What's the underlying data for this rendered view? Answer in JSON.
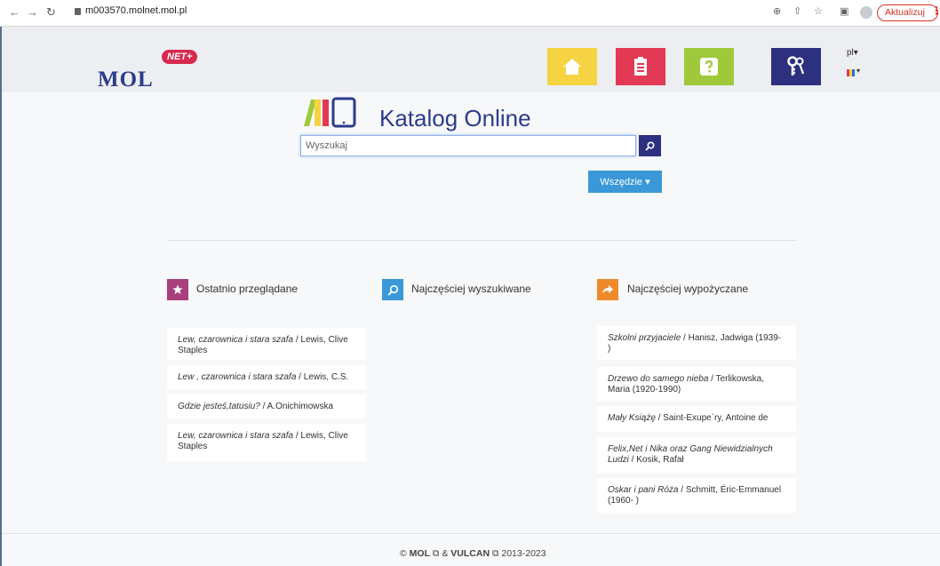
{
  "browser": {
    "url": "m003570.molnet.mol.pl",
    "update_label": "Aktualizuj"
  },
  "header": {
    "logo_main": "MOL",
    "logo_badge": "NET+",
    "lang_label": "pl"
  },
  "hero": {
    "title": "Katalog Online",
    "search_placeholder": "Wyszukaj",
    "scope_label": "Wszędzie"
  },
  "sections": {
    "recent": {
      "title": "Ostatnio przeglądane",
      "items": [
        {
          "title": "Lew, czarownica i stara szafa",
          "author": "Lewis, Clive Staples"
        },
        {
          "title": "Lew , czarownica i stara szafa",
          "author": "Lewis, C.S."
        },
        {
          "title": "Gdzie jesteś,tatusiu?",
          "author": "A.Onichimowska"
        },
        {
          "title": "Lew, czarownica i stara szafa",
          "author": "Lewis, Clive Staples"
        }
      ]
    },
    "searched": {
      "title": "Najczęściej wyszukiwane"
    },
    "borrowed": {
      "title": "Najczęściej wypożyczane",
      "items": [
        {
          "title": "Szkolni przyjaciele",
          "author": "Hanisz, Jadwiga (1939- )"
        },
        {
          "title": "Drzewo do samego nieba",
          "author": "Terlikowska, Maria (1920-1990)"
        },
        {
          "title": "Mały Książę",
          "author": "Saint-Exupe`ry, Antoine de"
        },
        {
          "title": "Felix,Net i Nika oraz Gang Niewidzialnych Ludzi",
          "author": "Kosik, Rafał"
        },
        {
          "title": "Oskar i pani Róża",
          "author": "Schmitt, Éric-Emmanuel (1960- )"
        }
      ]
    }
  },
  "footer": {
    "copyright": "©",
    "mol": "MOL",
    "and": "&",
    "vulcan": "VULCAN",
    "years": "2013-2023"
  },
  "colors": {
    "navy": "#2d2f7f",
    "yellow": "#f5d342",
    "red": "#e23a55",
    "green": "#9fc93a",
    "blue": "#3a98d8",
    "purple": "#a8407e",
    "orange": "#ef8a2c"
  }
}
